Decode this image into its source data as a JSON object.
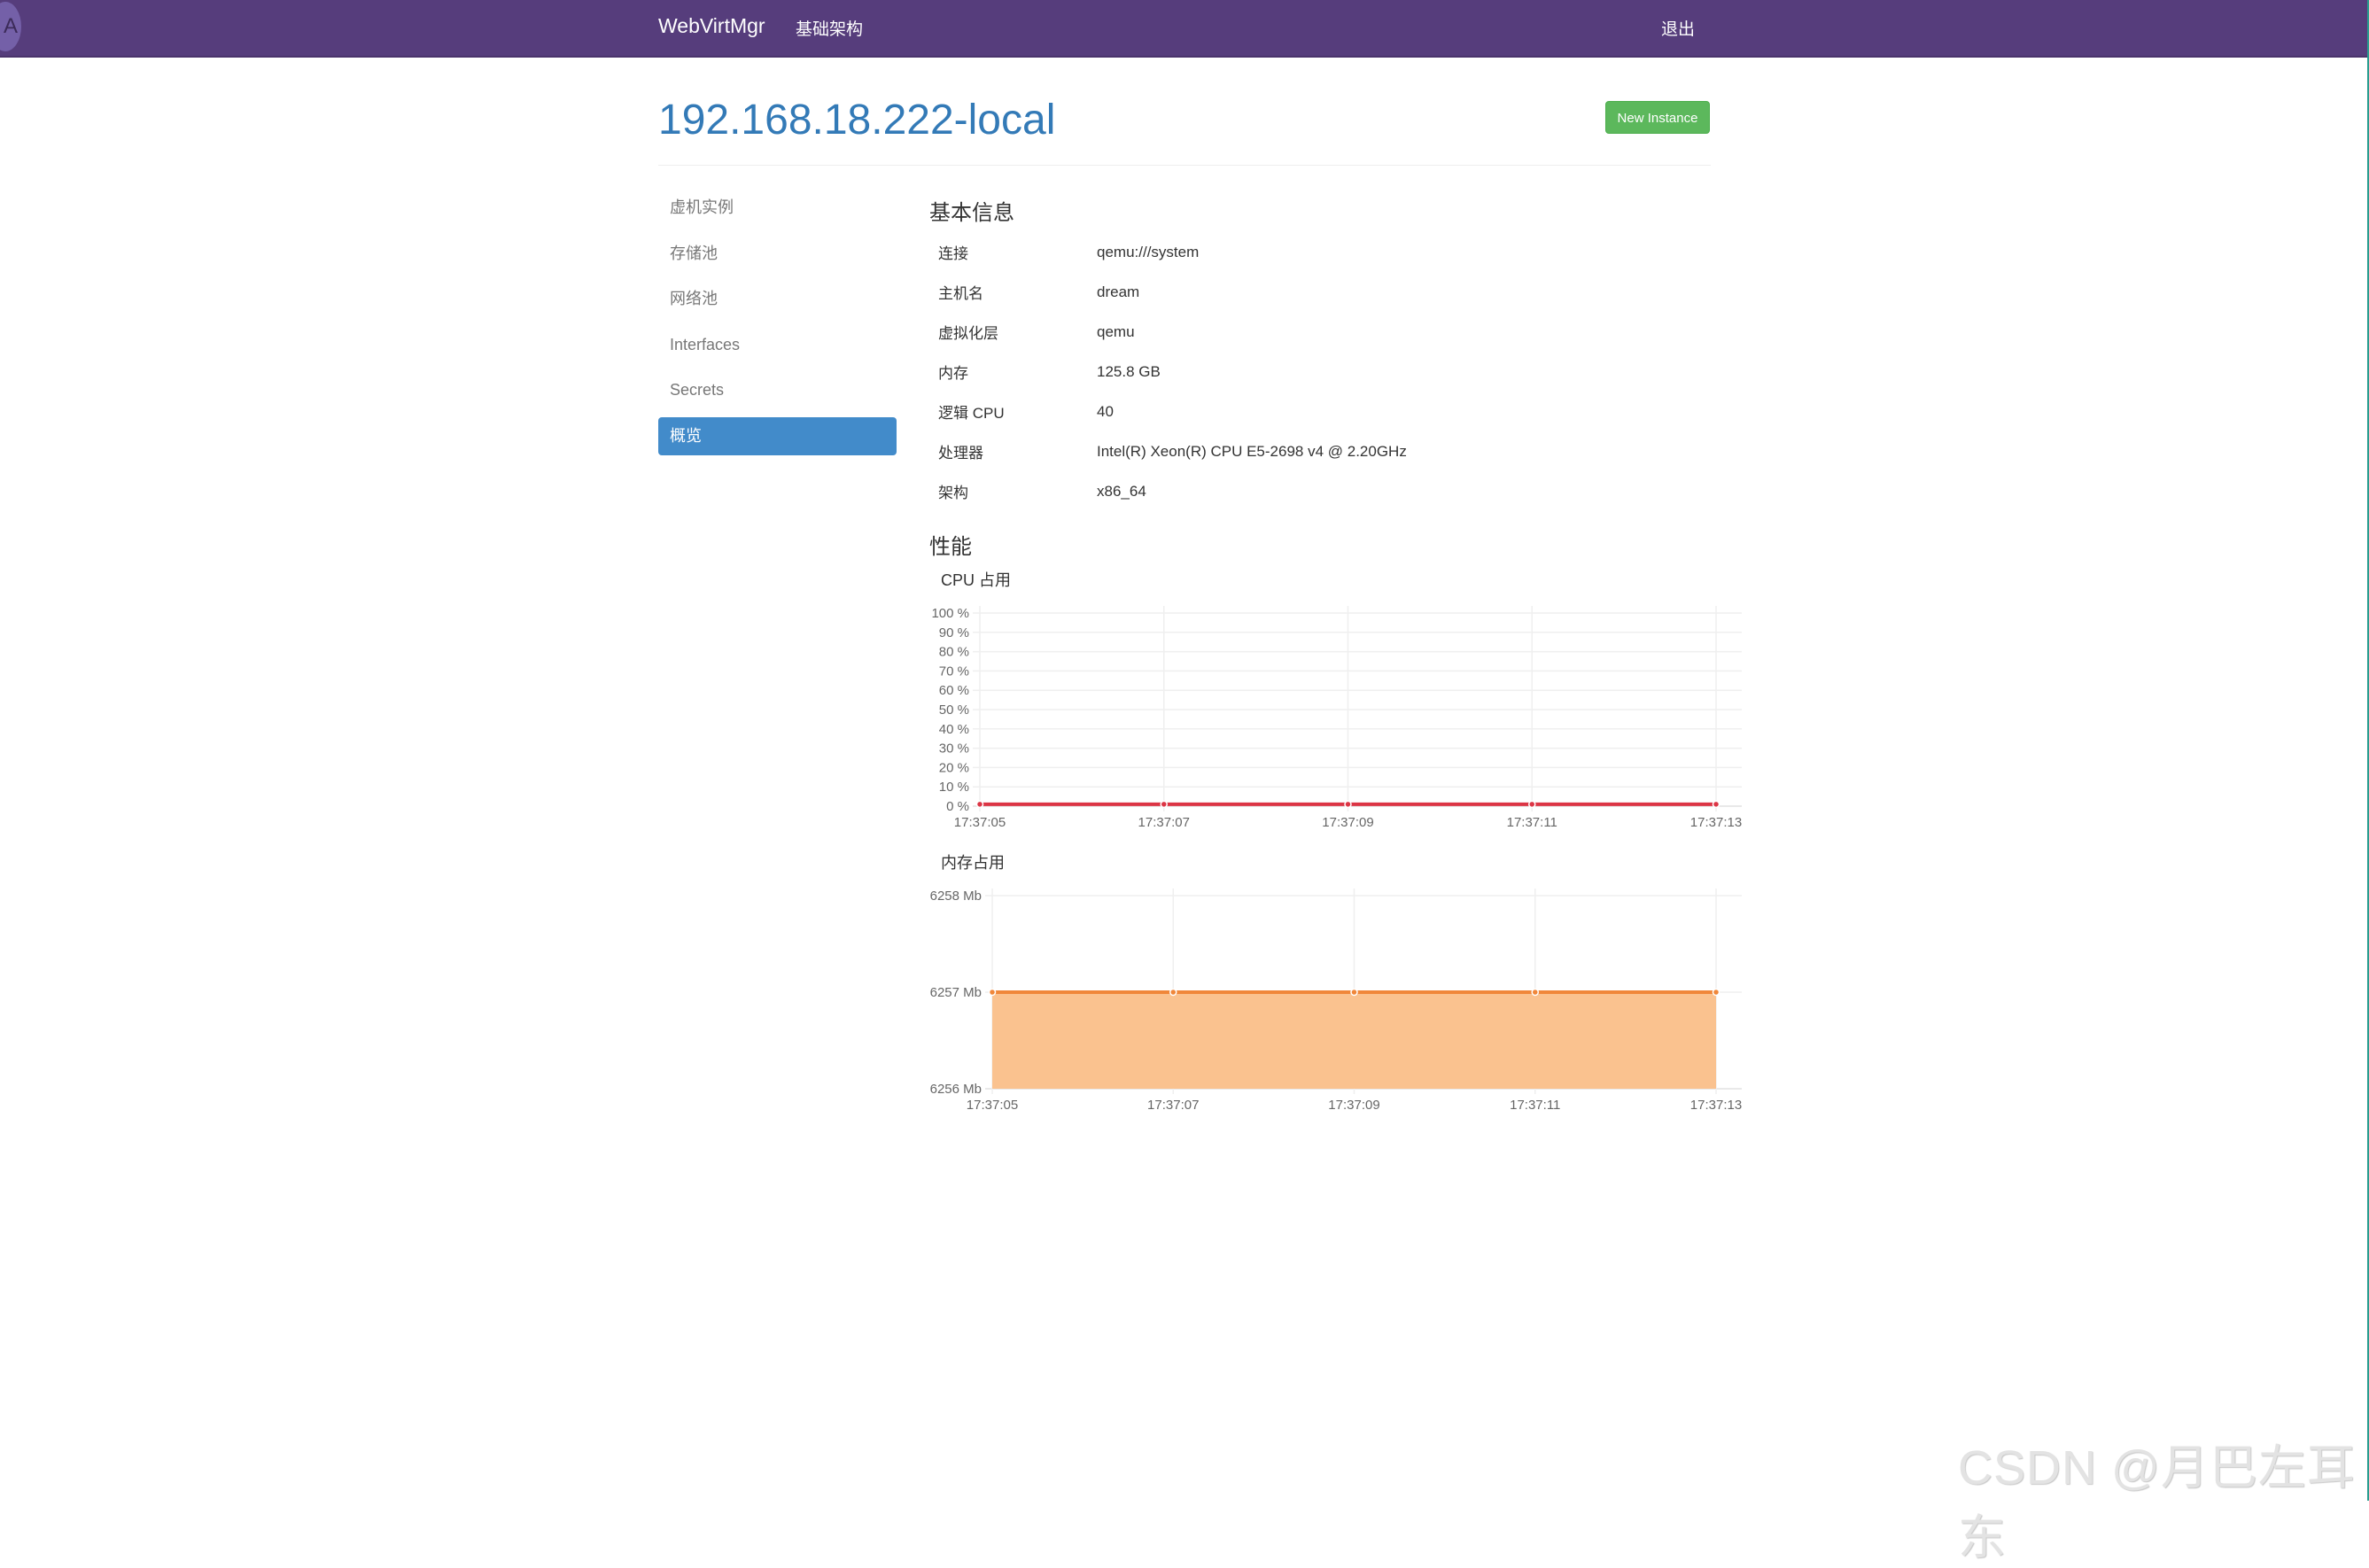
{
  "navbar": {
    "avatar_letter": "A",
    "brand": "WebVirtMgr",
    "infrastructure": "基础架构",
    "logout": "退出",
    "bg_color": "#563d7c"
  },
  "header": {
    "title": "192.168.18.222-local",
    "new_instance_label": "New Instance"
  },
  "sidebar": {
    "items": [
      {
        "label": "虚机实例",
        "active": false
      },
      {
        "label": "存储池",
        "active": false
      },
      {
        "label": "网络池",
        "active": false
      },
      {
        "label": "Interfaces",
        "active": false
      },
      {
        "label": "Secrets",
        "active": false
      },
      {
        "label": "概览",
        "active": true
      }
    ]
  },
  "basic_info": {
    "heading": "基本信息",
    "rows": [
      {
        "key": "连接",
        "value": "qemu:///system"
      },
      {
        "key": "主机名",
        "value": "dream"
      },
      {
        "key": "虚拟化层",
        "value": "qemu"
      },
      {
        "key": "内存",
        "value": "125.8 GB"
      },
      {
        "key": "逻辑 CPU",
        "value": "40"
      },
      {
        "key": "处理器",
        "value": "Intel(R) Xeon(R) CPU E5-2698 v4 @ 2.20GHz"
      },
      {
        "key": "架构",
        "value": "x86_64"
      }
    ]
  },
  "performance": {
    "heading": "性能"
  },
  "chart_data": [
    {
      "type": "line",
      "title": "CPU 占用",
      "x": [
        "17:37:05",
        "17:37:07",
        "17:37:09",
        "17:37:11",
        "17:37:13"
      ],
      "series": [
        {
          "name": "CPU",
          "values": [
            1,
            1,
            1,
            1,
            1
          ],
          "color": "#dc3545"
        }
      ],
      "yticks": [
        "0 %",
        "10 %",
        "20 %",
        "30 %",
        "40 %",
        "50 %",
        "60 %",
        "70 %",
        "80 %",
        "90 %",
        "100 %"
      ],
      "ylim": [
        0,
        100
      ],
      "xlabel": "",
      "ylabel": "",
      "grid": true
    },
    {
      "type": "area",
      "title": "内存占用",
      "x": [
        "17:37:05",
        "17:37:07",
        "17:37:09",
        "17:37:11",
        "17:37:13"
      ],
      "series": [
        {
          "name": "Memory",
          "values": [
            6257,
            6257,
            6257,
            6257,
            6257
          ],
          "color": "#f0873a",
          "fill": "#fac28f"
        }
      ],
      "yticks": [
        "6256 Mb",
        "6257 Mb",
        "6258 Mb"
      ],
      "ylim": [
        6256,
        6258
      ],
      "xlabel": "",
      "ylabel": "",
      "grid": true
    }
  ],
  "watermark": "CSDN @月巴左耳东"
}
